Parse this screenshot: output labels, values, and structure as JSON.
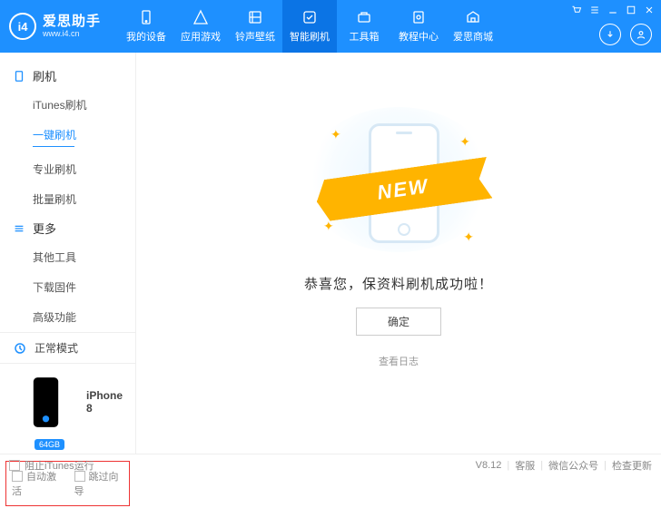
{
  "brand": {
    "name": "爱思助手",
    "url": "www.i4.cn",
    "logo_text": "i4"
  },
  "nav": [
    {
      "label": "我的设备"
    },
    {
      "label": "应用游戏"
    },
    {
      "label": "铃声壁纸"
    },
    {
      "label": "智能刷机"
    },
    {
      "label": "工具箱"
    },
    {
      "label": "教程中心"
    },
    {
      "label": "爱思商城"
    }
  ],
  "nav_active_index": 3,
  "sidebar": {
    "sections": [
      {
        "title": "刷机",
        "items": [
          "iTunes刷机",
          "一键刷机",
          "专业刷机",
          "批量刷机"
        ],
        "selected": 1
      },
      {
        "title": "更多",
        "items": [
          "其他工具",
          "下载固件",
          "高级功能"
        ],
        "selected": -1
      }
    ],
    "mode": "正常模式",
    "device": {
      "name": "iPhone 8",
      "storage": "64GB"
    },
    "options": {
      "auto_activate": "自动激活",
      "skip_wizard": "跳过向导"
    }
  },
  "main": {
    "ribbon": "NEW",
    "message": "恭喜您，保资料刷机成功啦！",
    "ok": "确定",
    "view_log": "查看日志"
  },
  "footer": {
    "block_itunes": "阻止iTunes运行",
    "version": "V8.12",
    "svc": "客服",
    "wechat": "微信公众号",
    "update": "检查更新"
  }
}
